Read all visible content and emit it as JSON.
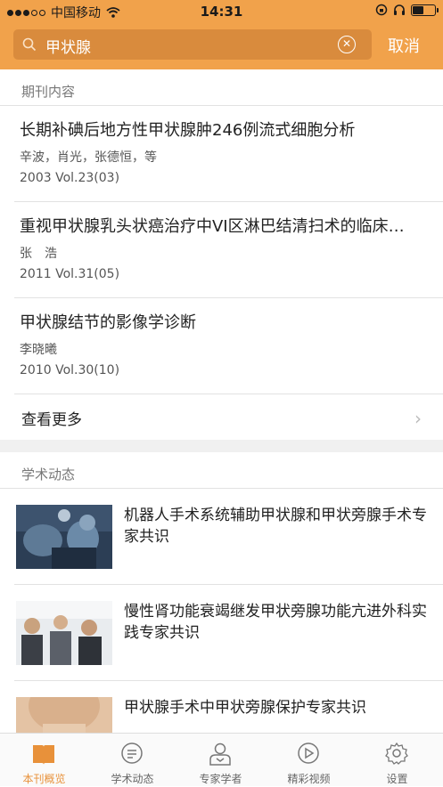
{
  "status_bar": {
    "carrier": "中国移动",
    "time": "14:31"
  },
  "search": {
    "value": "甲状腺",
    "cancel_label": "取消"
  },
  "journal_section": {
    "title": "期刊内容",
    "articles": [
      {
        "title": "长期补碘后地方性甲状腺肿246例流式细胞分析",
        "authors": "辛波，肖光，张德恒，等",
        "issue": "2003 Vol.23(03)"
      },
      {
        "title": "重视甲状腺乳头状癌治疗中VI区淋巴结清扫术的临床…",
        "authors": "张　浩",
        "issue": "2011 Vol.31(05)"
      },
      {
        "title": "甲状腺结节的影像学诊断",
        "authors": "李晓曦",
        "issue": "2010 Vol.30(10)"
      }
    ],
    "more_label": "查看更多"
  },
  "academic_section": {
    "title": "学术动态",
    "items": [
      {
        "title": "机器人手术系统辅助甲状腺和甲状旁腺手术专家共识"
      },
      {
        "title": "慢性肾功能衰竭继发甲状旁腺功能亢进外科实践专家共识"
      },
      {
        "title": "甲状腺手术中甲状旁腺保护专家共识"
      }
    ]
  },
  "tab_bar": {
    "tabs": [
      {
        "label": "本刊概览",
        "icon": "book-icon",
        "active": true
      },
      {
        "label": "学术动态",
        "icon": "chat-icon",
        "active": false
      },
      {
        "label": "专家学者",
        "icon": "person-icon",
        "active": false
      },
      {
        "label": "精彩视频",
        "icon": "play-icon",
        "active": false
      },
      {
        "label": "设置",
        "icon": "gear-icon",
        "active": false
      }
    ]
  },
  "colors": {
    "accent": "#f1a24b",
    "active_tab": "#e8913a"
  }
}
